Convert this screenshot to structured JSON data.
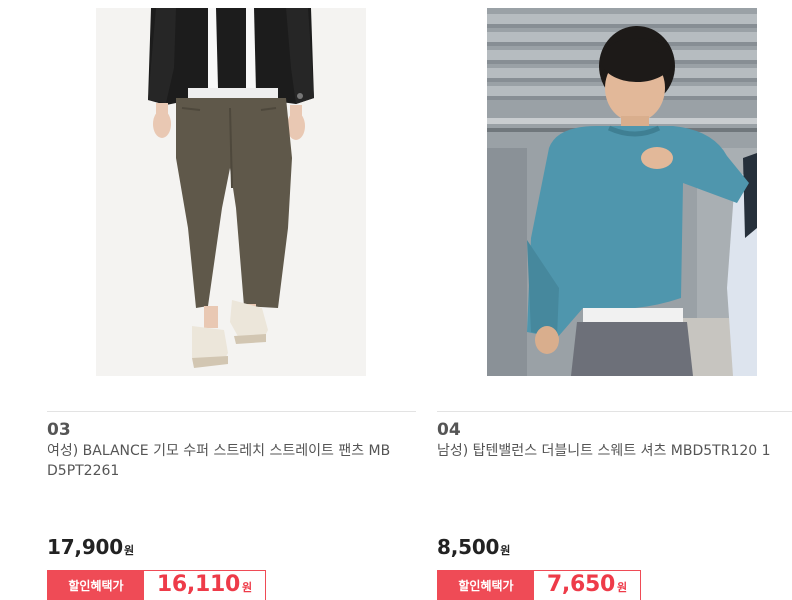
{
  "products": [
    {
      "rank": "03",
      "name": "여성) BALANCE 기모 수퍼 스트레치 스트레이트 팬츠 MBD5PT2261",
      "price": "17,900",
      "currency": "원",
      "sale_label": "할인혜택가",
      "sale_price": "16,110",
      "image_subject": "woman in black puffer jacket, khaki straight pants and cream sneakers",
      "colors": {
        "pants": "#5f584a",
        "jacket": "#1c1c1c",
        "background": "#f4f3f1"
      }
    },
    {
      "rank": "04",
      "name": "남성) 탑텐밸런스 더블니트 스웨트 셔츠 MBD5TR120 1",
      "price": "8,500",
      "currency": "원",
      "sale_label": "할인혜택가",
      "sale_price": "7,650",
      "image_subject": "man in teal-blue crewneck sweatshirt in stadium seats",
      "colors": {
        "sweatshirt": "#4f96ad",
        "background": "#9aa1a6"
      }
    }
  ],
  "accent_color": "#ef4b56"
}
